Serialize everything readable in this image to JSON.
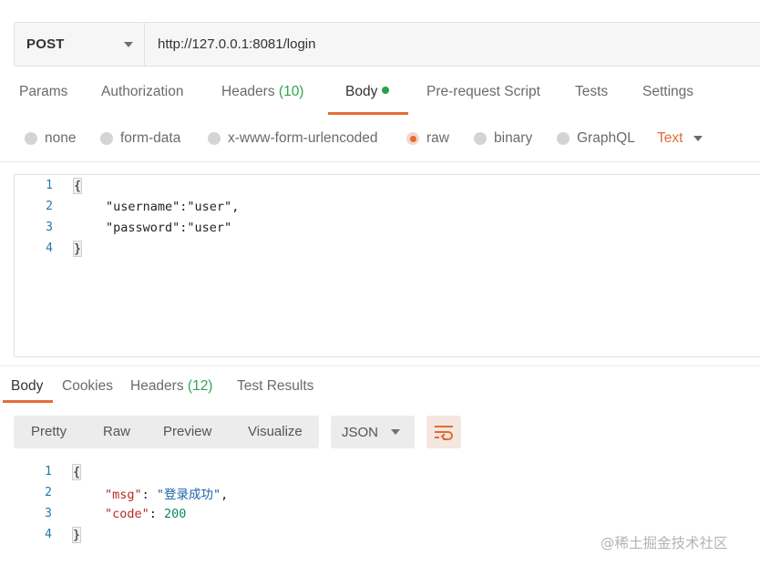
{
  "request": {
    "method": "POST",
    "url": "http://127.0.0.1:8081/login"
  },
  "req_tabs": {
    "params": "Params",
    "authorization": "Authorization",
    "headers": "Headers",
    "headers_count": "(10)",
    "body": "Body",
    "prerequest": "Pre-request Script",
    "tests": "Tests",
    "settings": "Settings"
  },
  "body_types": {
    "none": "none",
    "form_data": "form-data",
    "urlencoded": "x-www-form-urlencoded",
    "raw": "raw",
    "binary": "binary",
    "graphql": "GraphQL",
    "selected_format": "Text"
  },
  "request_body": {
    "line_numbers": [
      "1",
      "2",
      "3",
      "4"
    ],
    "open_brace": "{",
    "username_key": "\"username\"",
    "username_sep": ":",
    "username_value": "\"user\"",
    "username_comma": ",",
    "password_key": "\"password\"",
    "password_sep": ":",
    "password_value": "\"user\"",
    "close_brace": "}"
  },
  "res_tabs": {
    "body": "Body",
    "cookies": "Cookies",
    "headers": "Headers",
    "headers_count": "(12)",
    "test_results": "Test Results"
  },
  "res_toolbar": {
    "pretty": "Pretty",
    "raw": "Raw",
    "preview": "Preview",
    "visualize": "Visualize",
    "format": "JSON"
  },
  "response_body": {
    "line_numbers": [
      "1",
      "2",
      "3",
      "4"
    ],
    "open_brace": "{",
    "msg_key": "\"msg\"",
    "msg_sep": ": ",
    "msg_value": "\"登录成功\"",
    "msg_comma": ",",
    "code_key": "\"code\"",
    "code_sep": ": ",
    "code_value": "200",
    "close_brace": "}"
  },
  "watermark": "@稀土掘金技术社区",
  "colors": {
    "accent": "#e56d36",
    "count_green": "#2ea44f",
    "line_number": "#217aa8"
  },
  "icons": {
    "method_dropdown": "chevron-down-icon",
    "format_dropdown": "chevron-down-icon",
    "wrap": "wrap-lines-icon",
    "body_status": "dot-indicator-icon"
  }
}
